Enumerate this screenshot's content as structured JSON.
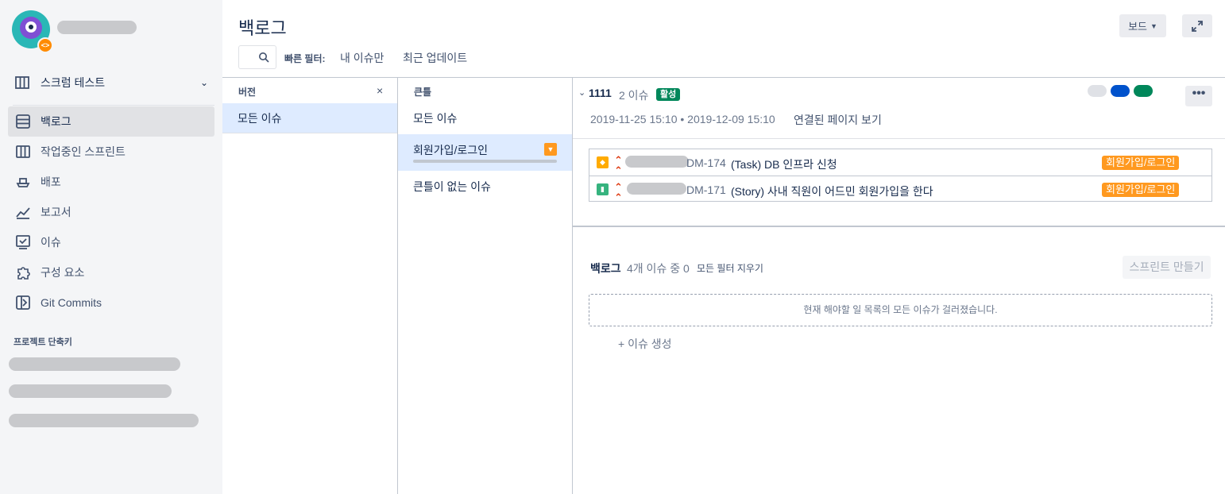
{
  "sidebar": {
    "project_name": "스크럼 테스트",
    "items": [
      {
        "label": "백로그",
        "icon": "backlog-icon"
      },
      {
        "label": "작업중인 스프린트",
        "icon": "board-icon"
      },
      {
        "label": "배포",
        "icon": "ship-icon"
      },
      {
        "label": "보고서",
        "icon": "chart-icon"
      },
      {
        "label": "이슈",
        "icon": "issues-icon"
      },
      {
        "label": "구성 요소",
        "icon": "puzzle-icon"
      },
      {
        "label": "Git Commits",
        "icon": "git-icon"
      }
    ],
    "shortcuts_label": "프로젝트 단축키"
  },
  "header": {
    "title": "백로그",
    "board_button": "보드",
    "quick_filter_label": "빠른 필터:",
    "quick_filters": [
      "내 이슈만",
      "최근 업데이트"
    ]
  },
  "versions": {
    "heading": "버전",
    "close": "×",
    "items": [
      "모든 이슈"
    ]
  },
  "epics": {
    "heading": "큰틀",
    "all": "모든 이슈",
    "selected": "회원가입/로그인",
    "none": "큰틀이 없는 이슈"
  },
  "sprint": {
    "name": "1111",
    "count": "2 이슈",
    "status": "활성",
    "dates": "2019-11-25 15:10 • 2019-12-09 15:10",
    "linked_page": "연결된 페이지 보기",
    "more": "•••",
    "issues": [
      {
        "key": "DM-174",
        "summary": "(Task) DB 인프라 신청",
        "type": "task-icon",
        "type_color": "#ffab00",
        "epic": "회원가입/로그인"
      },
      {
        "key": "DM-171",
        "summary": "(Story) 사내 직원이 어드민 회원가입을 한다",
        "type": "story-icon",
        "type_color": "#36b37e",
        "epic": "회원가입/로그인"
      }
    ]
  },
  "backlog": {
    "title": "백로그",
    "count": "4개 이슈 중 0",
    "clear_filters": "모든 필터 지우기",
    "create_sprint": "스프린트 만들기",
    "empty_message": "현재 해야할 일 목록의 모든 이슈가 걸러졌습니다.",
    "create_issue": "+  이슈 생성"
  }
}
